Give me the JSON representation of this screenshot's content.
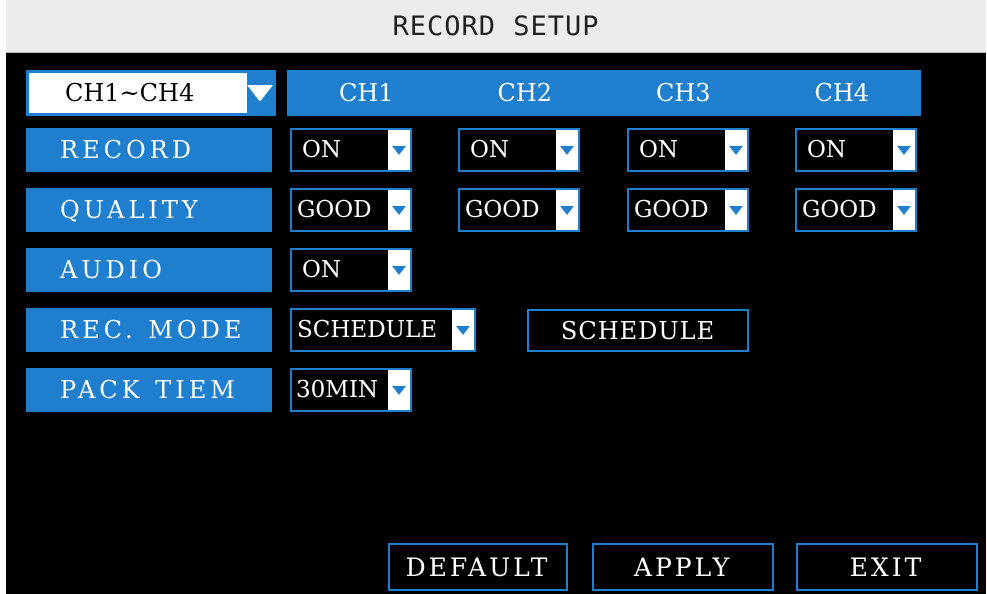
{
  "window": {
    "title": "RECORD SETUP"
  },
  "channel_range": {
    "value": "CH1~CH4"
  },
  "channels": [
    "CH1",
    "CH2",
    "CH3",
    "CH4"
  ],
  "rows": {
    "record": {
      "label": "RECORD",
      "values": [
        "ON",
        "ON",
        "ON",
        "ON"
      ]
    },
    "quality": {
      "label": "QUALITY",
      "values": [
        "GOOD",
        "GOOD",
        "GOOD",
        "GOOD"
      ]
    },
    "audio": {
      "label": "AUDIO",
      "value": "ON"
    },
    "rec_mode": {
      "label": "REC. MODE",
      "value": "SCHEDULE",
      "schedule_button": "SCHEDULE"
    },
    "pack_time": {
      "label": "PACK TIEM",
      "value": "30MIN"
    }
  },
  "footer": {
    "default_label": "DEFAULT",
    "apply_label": "APPLY",
    "exit_label": "EXIT"
  },
  "colors": {
    "accent": "#1f7fce",
    "background": "#000000",
    "title_bar": "#ececec"
  }
}
